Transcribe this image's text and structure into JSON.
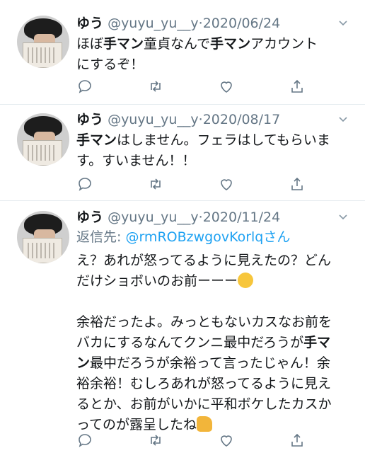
{
  "tweets": [
    {
      "name": "ゆう",
      "handle": "@yuyu_yu__y",
      "date": "·2020/06/24",
      "text_parts": [
        "ほぼ",
        "手マン",
        "童貞なんで",
        "手マン",
        "アカウント",
        "にするぞ！"
      ]
    },
    {
      "name": "ゆう",
      "handle": "@yuyu_yu__y",
      "date": "·2020/08/17",
      "text_parts": [
        "手マン",
        "はしません。フェラはしてもらいま",
        "す。すいません！！"
      ]
    },
    {
      "name": "ゆう",
      "handle": "@yuyu_yu__y",
      "date": "·2020/11/24",
      "reply_prefix": "返信先: ",
      "reply_to": "@rmROBzwgovKorlqさん",
      "para1_line1": "え？あれが怒ってるように見えたの？どん",
      "para1_line2": "だけショボいのお前ーーー",
      "para2_line1": "余裕だったよ。みっともないカスなお前を",
      "para2_line2a": "バカにするなんてクンニ最中だろうが",
      "para2_bold1": "手マ",
      "para2_bold2": "ン",
      "para2_line3": "最中だろうが余裕って言ったじゃん！余",
      "para2_line4": "裕余裕！むしろあれが怒ってるように見え",
      "para2_line5": "るとか、お前がいかに平和ボケしたカスか",
      "para2_line6": "ってのが露呈したね"
    }
  ],
  "icons": [
    "reply-icon",
    "retweet-icon",
    "like-icon",
    "share-icon",
    "chevron-down-icon"
  ],
  "colors": {
    "link": "#1da1f2",
    "secondary": "#657786",
    "divider": "#e6ecf0"
  }
}
